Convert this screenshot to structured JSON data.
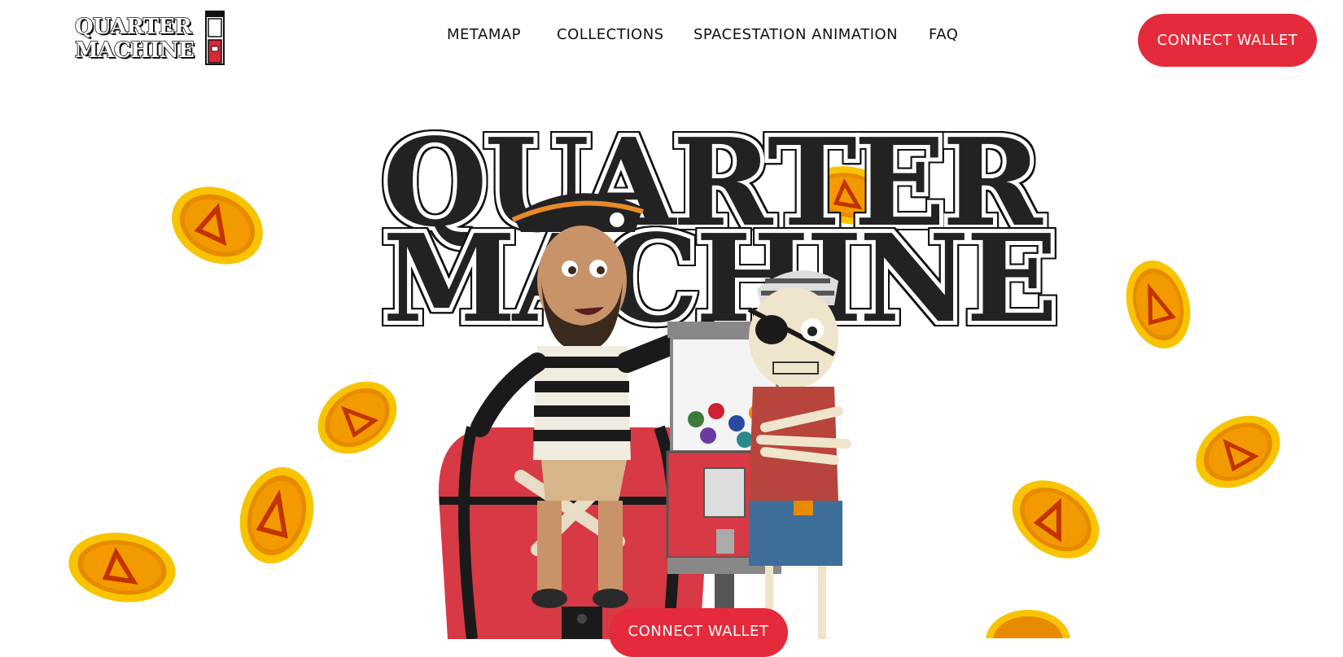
{
  "header": {
    "logo": {
      "line1": "QUARTER",
      "line2": "MACHINE"
    },
    "nav": [
      {
        "label": "METAMAP"
      },
      {
        "label": "COLLECTIONS"
      },
      {
        "label": "SPACESTATION ANIMATION"
      },
      {
        "label": "FAQ"
      }
    ],
    "connect_label": "CONNECT WALLET"
  },
  "hero": {
    "title_line1": "QUARTER",
    "title_line2": "MACHINE",
    "connect_label": "CONNECT WALLET"
  },
  "colors": {
    "accent": "#e52a3c",
    "title": "#222222",
    "coin_gold": "#f5b400",
    "coin_orange": "#e36a00"
  },
  "icons": [
    "quarter-machine-logo",
    "gold-coin-icon",
    "pirate-character",
    "skeleton-character",
    "treasure-chest",
    "gumball-machine"
  ]
}
